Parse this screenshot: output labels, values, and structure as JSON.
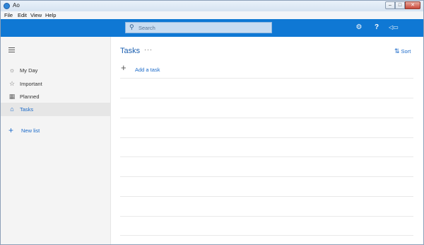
{
  "window": {
    "title": "Ao",
    "minimize": "–",
    "maximize": "□",
    "close": "✕"
  },
  "menu": [
    "File",
    "Edit",
    "View",
    "Help"
  ],
  "header": {
    "search_placeholder": "Search",
    "icons": [
      "settings-icon",
      "help-icon",
      "feedback-icon"
    ],
    "settings_glyph": "⚙",
    "help_glyph": "?",
    "feedback_glyph": "📢",
    "color": "#0f78d4"
  },
  "sidebar": {
    "items": [
      {
        "label": "My Day",
        "icon": "sun-icon",
        "glyph": "☼"
      },
      {
        "label": "Important",
        "icon": "star-icon",
        "glyph": "☆"
      },
      {
        "label": "Planned",
        "icon": "calendar-icon",
        "glyph": "▦"
      },
      {
        "label": "Tasks",
        "icon": "home-icon",
        "glyph": "⌂",
        "active": true
      }
    ],
    "new_list": "New list"
  },
  "main": {
    "title": "Tasks",
    "more": "···",
    "sort_label": "Sort",
    "sort_glyph": "⇅",
    "add_task": "Add a task",
    "plus": "+"
  }
}
